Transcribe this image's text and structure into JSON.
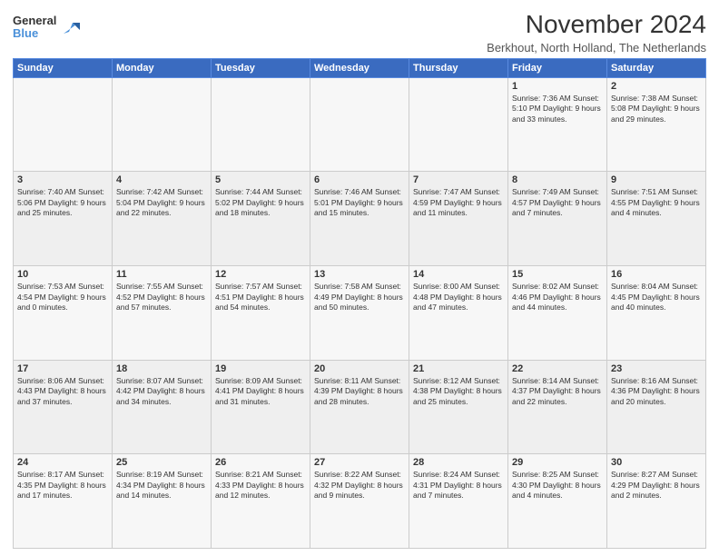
{
  "logo": {
    "general": "General",
    "blue": "Blue"
  },
  "title": "November 2024",
  "subtitle": "Berkhout, North Holland, The Netherlands",
  "header_days": [
    "Sunday",
    "Monday",
    "Tuesday",
    "Wednesday",
    "Thursday",
    "Friday",
    "Saturday"
  ],
  "weeks": [
    [
      {
        "day": "",
        "info": ""
      },
      {
        "day": "",
        "info": ""
      },
      {
        "day": "",
        "info": ""
      },
      {
        "day": "",
        "info": ""
      },
      {
        "day": "",
        "info": ""
      },
      {
        "day": "1",
        "info": "Sunrise: 7:36 AM\nSunset: 5:10 PM\nDaylight: 9 hours and 33 minutes."
      },
      {
        "day": "2",
        "info": "Sunrise: 7:38 AM\nSunset: 5:08 PM\nDaylight: 9 hours and 29 minutes."
      }
    ],
    [
      {
        "day": "3",
        "info": "Sunrise: 7:40 AM\nSunset: 5:06 PM\nDaylight: 9 hours and 25 minutes."
      },
      {
        "day": "4",
        "info": "Sunrise: 7:42 AM\nSunset: 5:04 PM\nDaylight: 9 hours and 22 minutes."
      },
      {
        "day": "5",
        "info": "Sunrise: 7:44 AM\nSunset: 5:02 PM\nDaylight: 9 hours and 18 minutes."
      },
      {
        "day": "6",
        "info": "Sunrise: 7:46 AM\nSunset: 5:01 PM\nDaylight: 9 hours and 15 minutes."
      },
      {
        "day": "7",
        "info": "Sunrise: 7:47 AM\nSunset: 4:59 PM\nDaylight: 9 hours and 11 minutes."
      },
      {
        "day": "8",
        "info": "Sunrise: 7:49 AM\nSunset: 4:57 PM\nDaylight: 9 hours and 7 minutes."
      },
      {
        "day": "9",
        "info": "Sunrise: 7:51 AM\nSunset: 4:55 PM\nDaylight: 9 hours and 4 minutes."
      }
    ],
    [
      {
        "day": "10",
        "info": "Sunrise: 7:53 AM\nSunset: 4:54 PM\nDaylight: 9 hours and 0 minutes."
      },
      {
        "day": "11",
        "info": "Sunrise: 7:55 AM\nSunset: 4:52 PM\nDaylight: 8 hours and 57 minutes."
      },
      {
        "day": "12",
        "info": "Sunrise: 7:57 AM\nSunset: 4:51 PM\nDaylight: 8 hours and 54 minutes."
      },
      {
        "day": "13",
        "info": "Sunrise: 7:58 AM\nSunset: 4:49 PM\nDaylight: 8 hours and 50 minutes."
      },
      {
        "day": "14",
        "info": "Sunrise: 8:00 AM\nSunset: 4:48 PM\nDaylight: 8 hours and 47 minutes."
      },
      {
        "day": "15",
        "info": "Sunrise: 8:02 AM\nSunset: 4:46 PM\nDaylight: 8 hours and 44 minutes."
      },
      {
        "day": "16",
        "info": "Sunrise: 8:04 AM\nSunset: 4:45 PM\nDaylight: 8 hours and 40 minutes."
      }
    ],
    [
      {
        "day": "17",
        "info": "Sunrise: 8:06 AM\nSunset: 4:43 PM\nDaylight: 8 hours and 37 minutes."
      },
      {
        "day": "18",
        "info": "Sunrise: 8:07 AM\nSunset: 4:42 PM\nDaylight: 8 hours and 34 minutes."
      },
      {
        "day": "19",
        "info": "Sunrise: 8:09 AM\nSunset: 4:41 PM\nDaylight: 8 hours and 31 minutes."
      },
      {
        "day": "20",
        "info": "Sunrise: 8:11 AM\nSunset: 4:39 PM\nDaylight: 8 hours and 28 minutes."
      },
      {
        "day": "21",
        "info": "Sunrise: 8:12 AM\nSunset: 4:38 PM\nDaylight: 8 hours and 25 minutes."
      },
      {
        "day": "22",
        "info": "Sunrise: 8:14 AM\nSunset: 4:37 PM\nDaylight: 8 hours and 22 minutes."
      },
      {
        "day": "23",
        "info": "Sunrise: 8:16 AM\nSunset: 4:36 PM\nDaylight: 8 hours and 20 minutes."
      }
    ],
    [
      {
        "day": "24",
        "info": "Sunrise: 8:17 AM\nSunset: 4:35 PM\nDaylight: 8 hours and 17 minutes."
      },
      {
        "day": "25",
        "info": "Sunrise: 8:19 AM\nSunset: 4:34 PM\nDaylight: 8 hours and 14 minutes."
      },
      {
        "day": "26",
        "info": "Sunrise: 8:21 AM\nSunset: 4:33 PM\nDaylight: 8 hours and 12 minutes."
      },
      {
        "day": "27",
        "info": "Sunrise: 8:22 AM\nSunset: 4:32 PM\nDaylight: 8 hours and 9 minutes."
      },
      {
        "day": "28",
        "info": "Sunrise: 8:24 AM\nSunset: 4:31 PM\nDaylight: 8 hours and 7 minutes."
      },
      {
        "day": "29",
        "info": "Sunrise: 8:25 AM\nSunset: 4:30 PM\nDaylight: 8 hours and 4 minutes."
      },
      {
        "day": "30",
        "info": "Sunrise: 8:27 AM\nSunset: 4:29 PM\nDaylight: 8 hours and 2 minutes."
      }
    ]
  ]
}
